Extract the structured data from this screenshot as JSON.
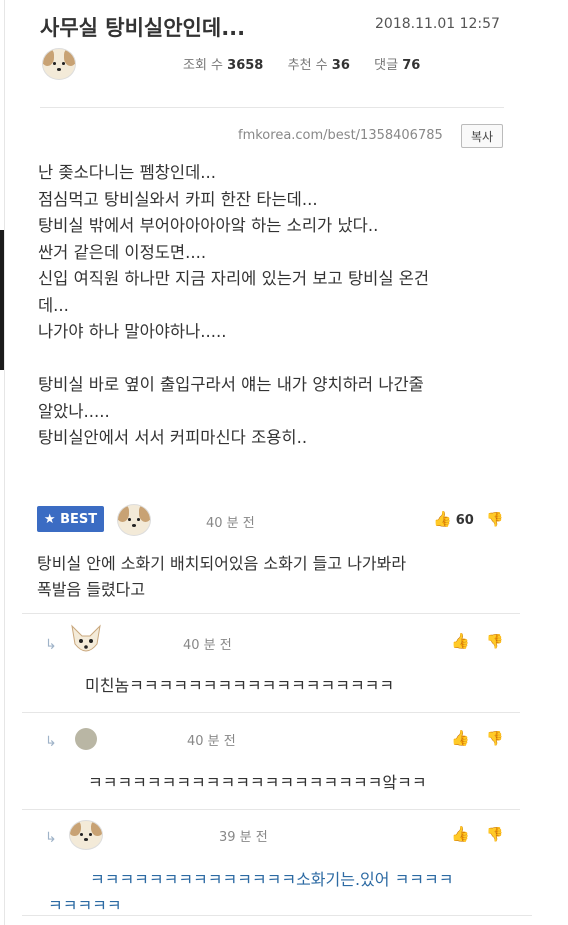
{
  "post": {
    "title": "사무실 탕비실안인데...",
    "date": "2018.11.01 12:57",
    "views_label": "조회 수",
    "views": "3658",
    "recommend_label": "추천 수",
    "recommend": "36",
    "comments_label": "댓글",
    "comments": "76",
    "url": "fmkorea.com/best/1358406785",
    "copy_label": "복사",
    "body": [
      "난 좆소다니는 펨창인데...",
      "점심먹고 탕비실와서 카피 한잔 타는데...",
      "탕비실 밖에서 부어아아아아앜 하는 소리가 났다..",
      "싼거 같은데 이정도면....",
      "신입 여직원 하나만 지금 자리에 있는거 보고 탕비실 온건",
      "데...",
      "나가야 하나 말아야하나.....",
      "",
      "탕비실 바로 옆이 출입구라서 얘는 내가 양치하러 나간줄",
      "알았나.....",
      "탕비실안에서 서서 커피마신다 조용히.."
    ]
  },
  "best_comment": {
    "badge": "★ BEST",
    "time": "40 분 전",
    "likes": "60",
    "text_line1": "탕비실 안에 소화기 배치되어있음 소화기 들고 나가봐라",
    "text_line2": "폭발음 들렸다고"
  },
  "replies": [
    {
      "time": "40 분 전",
      "text": "미친놈ㅋㅋㅋㅋㅋㅋㅋㅋㅋㅋㅋㅋㅋㅋㅋㅋㅋㅋ"
    },
    {
      "time": "40 분 전",
      "text": "ㅋㅋㅋㅋㅋㅋㅋㅋㅋㅋㅋㅋㅋㅋㅋㅋㅋㅋㅋㅋ앜ㅋㅋ"
    },
    {
      "time": "39 분 전",
      "text_a": "ㅋㅋㅋㅋㅋㅋㅋㅋㅋㅋㅋㅋㅋㅋ소화기는.있어 ㅋㅋㅋㅋ",
      "text_b": "ㅋㅋㅋㅋㅋ"
    }
  ],
  "icons": {
    "like": "thumb-up",
    "dislike": "thumb-down",
    "reply": "reply-arrow"
  }
}
